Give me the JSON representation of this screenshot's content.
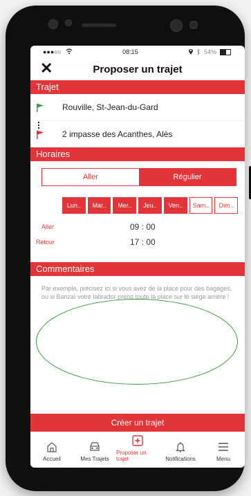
{
  "status": {
    "time": "08:15",
    "battery": "54%",
    "battery_fill_fraction": 0.54
  },
  "nav": {
    "close_label": "✕",
    "title": "Proposer un trajet"
  },
  "trajet": {
    "section_title": "Trajet",
    "from": "Rouville, St-Jean-du-Gard",
    "to": "2 impasse des Acanthes, Alès",
    "from_flag_color": "#2f9e44",
    "to_flag_color": "#e2353a"
  },
  "horaires": {
    "section_title": "Horaires",
    "mode_options": [
      "Aller",
      "Régulier"
    ],
    "selected_mode": "Régulier",
    "days": [
      {
        "label": "Lun..",
        "selected": true
      },
      {
        "label": "Mar..",
        "selected": true
      },
      {
        "label": "Mer..",
        "selected": true
      },
      {
        "label": "Jeu..",
        "selected": true
      },
      {
        "label": "Ven..",
        "selected": true
      },
      {
        "label": "Sam..",
        "selected": false
      },
      {
        "label": "Dim..",
        "selected": false
      }
    ],
    "aller_label": "Aller",
    "aller_time": "09 : 00",
    "retour_label": "Retour",
    "retour_time": "17 : 00"
  },
  "commentaires": {
    "section_title": "Commentaires",
    "placeholder": "Par exemple, précisez ici si vous avez de la place pour des bagages, ou si Banzaï votre labrador prend toute la place sur le siège arrière !"
  },
  "create_button": "Créer un trajet",
  "tabbar": [
    {
      "label": "Accueil",
      "icon": "home-icon",
      "active": false
    },
    {
      "label": "Mes Trajets",
      "icon": "car-icon",
      "active": false
    },
    {
      "label": "Proposer un trajet",
      "icon": "plus-box-icon",
      "active": true
    },
    {
      "label": "Notifications",
      "icon": "bell-icon",
      "active": false
    },
    {
      "label": "Menu",
      "icon": "menu-icon",
      "active": false
    }
  ],
  "colors": {
    "accent": "#e2353a",
    "annotation": "#3a9a3a"
  }
}
